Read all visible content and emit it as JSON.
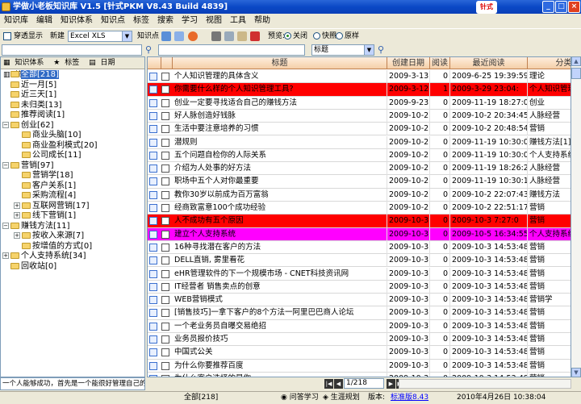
{
  "window": {
    "title": "学做小老板知识库 V1.5 [针式PKM V8.43 Build 4839]",
    "logo_text": "针式",
    "min": "_",
    "max": "□",
    "close": "×"
  },
  "menu": [
    "知识库",
    "编辑",
    "知识体系",
    "知识点",
    "标签",
    "搜索",
    "学习",
    "视图",
    "工具",
    "帮助"
  ],
  "toolbar": {
    "pass_display": "穿透显示",
    "new_label": "新建",
    "new_combo": "Excel XLS",
    "knowledge_label": "知识点",
    "preview_label": "预览:",
    "radio_off": "关闭",
    "radio_quick": "快照",
    "radio_orig": "原样"
  },
  "search": {
    "field_combo": "标题"
  },
  "left_tabs": [
    "知识体系",
    "标签",
    "日期",
    "统计"
  ],
  "tree": [
    {
      "label": "全部[218]",
      "depth": 0,
      "expander": "",
      "selected": true
    },
    {
      "label": "近一月[5]",
      "depth": 0,
      "expander": ""
    },
    {
      "label": "近三天[1]",
      "depth": 0,
      "expander": ""
    },
    {
      "label": "未归类[13]",
      "depth": 0,
      "expander": ""
    },
    {
      "label": "推荐阅读[1]",
      "depth": 0,
      "expander": ""
    },
    {
      "label": "创业[62]",
      "depth": 0,
      "expander": "−"
    },
    {
      "label": "商业头脑[10]",
      "depth": 1,
      "expander": ""
    },
    {
      "label": "商业盈利模式[20]",
      "depth": 1,
      "expander": ""
    },
    {
      "label": "公司成长[11]",
      "depth": 1,
      "expander": ""
    },
    {
      "label": "营销[97]",
      "depth": 0,
      "expander": "−"
    },
    {
      "label": "营销学[18]",
      "depth": 1,
      "expander": ""
    },
    {
      "label": "客户关系[1]",
      "depth": 1,
      "expander": ""
    },
    {
      "label": "采购流程[4]",
      "depth": 1,
      "expander": ""
    },
    {
      "label": "互联网营销[17]",
      "depth": 1,
      "expander": "+"
    },
    {
      "label": "线下营销[1]",
      "depth": 1,
      "expander": "+"
    },
    {
      "label": "赚钱方法[11]",
      "depth": 0,
      "expander": "−"
    },
    {
      "label": "按收入来源[7]",
      "depth": 1,
      "expander": "+"
    },
    {
      "label": "按增值的方式[0]",
      "depth": 1,
      "expander": ""
    },
    {
      "label": "个人支持系统[34]",
      "depth": 0,
      "expander": "+"
    },
    {
      "label": "回收站[0]",
      "depth": 0,
      "expander": ""
    }
  ],
  "grid": {
    "headers": [
      "标题",
      "创建日期",
      "阅读",
      "最近阅读",
      "分类"
    ],
    "rows": [
      {
        "title": "个人知识管理的具体含义",
        "created": "2009-3-13",
        "reads": "0",
        "last": "2009-6-25 19:39:59",
        "cat": "理论",
        "bg": ""
      },
      {
        "title": "你需要什么样的个人知识管理工具?",
        "created": "2009-3-12",
        "reads": "1",
        "last": "2009-3-29 23:04:",
        "cat": "个人知识管理",
        "bg": "#ff0000"
      },
      {
        "title": "创业一定要寻找适合自己的赚钱方法",
        "created": "2009-9-23",
        "reads": "0",
        "last": "2009-11-19 18:27:03",
        "cat": "创业",
        "bg": ""
      },
      {
        "title": "好人脉创造好钱脉",
        "created": "2009-10-2",
        "reads": "0",
        "last": "2009-10-2 20:34:45",
        "cat": "人脉经营",
        "bg": ""
      },
      {
        "title": "生活中要注意培养的习惯",
        "created": "2009-10-2",
        "reads": "0",
        "last": "2009-10-2 20:48:54",
        "cat": "营销",
        "bg": ""
      },
      {
        "title": "潜规则",
        "created": "2009-10-2",
        "reads": "0",
        "last": "2009-11-19 10:30:03",
        "cat": "赚钱方法[1]",
        "bg": ""
      },
      {
        "title": "五个问题自检你的人际关系",
        "created": "2009-10-2",
        "reads": "0",
        "last": "2009-11-19 10:30:08",
        "cat": "个人支持系统",
        "bg": ""
      },
      {
        "title": "介绍为人处事的好方法",
        "created": "2009-10-2",
        "reads": "0",
        "last": "2009-11-19 18:26:24",
        "cat": "人脉经营",
        "bg": ""
      },
      {
        "title": "职场中五个人对你最重要",
        "created": "2009-10-2",
        "reads": "0",
        "last": "2009-11-19 10:30:12",
        "cat": "人脉经营",
        "bg": ""
      },
      {
        "title": "教你30岁以前成为百万富翁",
        "created": "2009-10-2",
        "reads": "0",
        "last": "2009-10-2 22:07:43",
        "cat": "赚钱方法",
        "bg": ""
      },
      {
        "title": "经商致富意100个成功经验",
        "created": "2009-10-2",
        "reads": "0",
        "last": "2009-10-2 22:51:17",
        "cat": "营销",
        "bg": ""
      },
      {
        "title": "人不成功有五个原因",
        "created": "2009-10-3",
        "reads": "0",
        "last": "2009-10-3 7:27:0",
        "cat": "营销",
        "bg": "#ff0000"
      },
      {
        "title": "建立个人支持系统",
        "created": "2009-10-3",
        "reads": "0",
        "last": "2009-10-5 16:34:55",
        "cat": "个人支持系统",
        "bg": "#ff00ff"
      },
      {
        "title": "16种寻找潜在客户的方法",
        "created": "2009-10-3",
        "reads": "0",
        "last": "2009-10-3 14:53:48",
        "cat": "营销",
        "bg": ""
      },
      {
        "title": "DELL直销, 雾里看花",
        "created": "2009-10-3",
        "reads": "0",
        "last": "2009-10-3 14:53:48",
        "cat": "营销",
        "bg": ""
      },
      {
        "title": "eHR管理软件的下一个规模市场 - CNET科技资讯网",
        "created": "2009-10-3",
        "reads": "0",
        "last": "2009-10-3 14:53:48",
        "cat": "营销",
        "bg": ""
      },
      {
        "title": "IT经营者 销售卖点的创意",
        "created": "2009-10-3",
        "reads": "0",
        "last": "2009-10-3 14:53:48",
        "cat": "营销",
        "bg": ""
      },
      {
        "title": "WEB营销模式",
        "created": "2009-10-3",
        "reads": "0",
        "last": "2009-10-3 14:53:48",
        "cat": "营销学",
        "bg": ""
      },
      {
        "title": "[销售技巧]一拿下客户的8个方法一阿里巴巴商人论坛",
        "created": "2009-10-3",
        "reads": "0",
        "last": "2009-10-3 14:53:48",
        "cat": "营销",
        "bg": ""
      },
      {
        "title": "一个老业务员自曝交易绝招",
        "created": "2009-10-3",
        "reads": "0",
        "last": "2009-10-3 14:53:48",
        "cat": "营销",
        "bg": ""
      },
      {
        "title": "业务员报价技巧",
        "created": "2009-10-3",
        "reads": "0",
        "last": "2009-10-3 14:53:48",
        "cat": "营销",
        "bg": ""
      },
      {
        "title": "中国式公关",
        "created": "2009-10-3",
        "reads": "0",
        "last": "2009-10-3 14:53:48",
        "cat": "营销",
        "bg": ""
      },
      {
        "title": "为什么你要推荐百度",
        "created": "2009-10-3",
        "reads": "0",
        "last": "2009-10-3 14:53:48",
        "cat": "营销",
        "bg": ""
      },
      {
        "title": "为什么客户选择的是你",
        "created": "2009-10-3",
        "reads": "0",
        "last": "2009-10-3 14:53:48",
        "cat": "营销",
        "bg": ""
      }
    ]
  },
  "pager": {
    "text": "1/218"
  },
  "tip": "一个人能够成功，首先是一个能很好管理自己的人",
  "status": {
    "count": "全部[218]",
    "ask": "问答学习",
    "career": "生涯规划",
    "version_label": "版本:",
    "version": "标准版8.43",
    "datetime": "2010年4月26日  10:38:04"
  }
}
